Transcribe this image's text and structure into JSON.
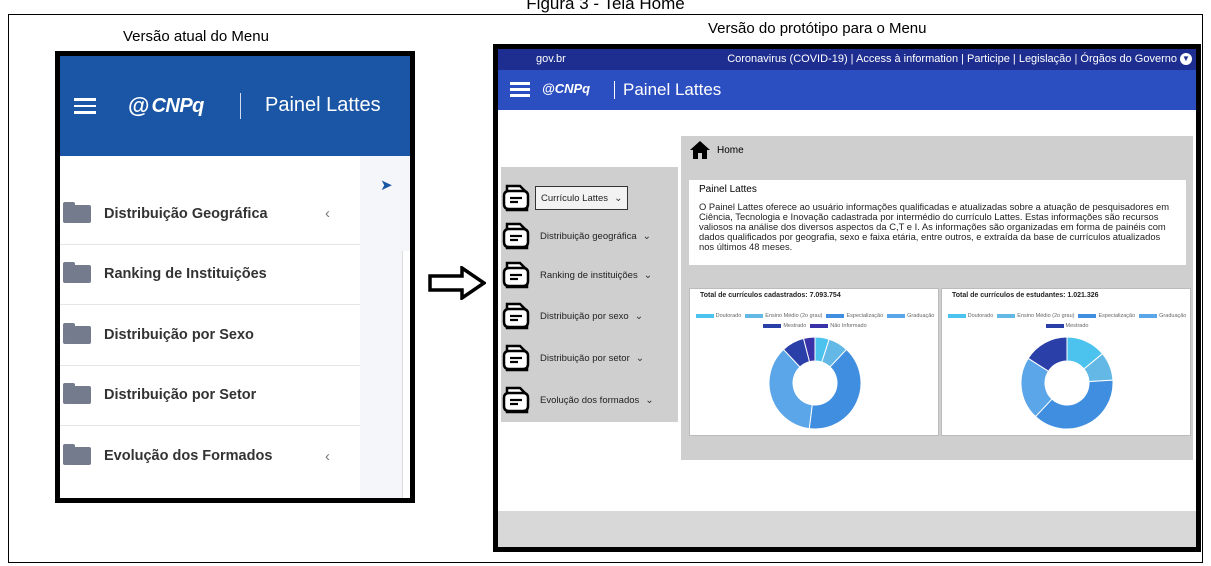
{
  "figure": {
    "title": "Figura 3 - Tela Home",
    "caption_left": "Versão atual do Menu",
    "caption_right": "Versão do protótipo para o Menu"
  },
  "current_menu": {
    "logo": "CNPq",
    "title": "Painel Lattes",
    "items": [
      {
        "label": "Distribuição Geográfica",
        "chevron": "‹"
      },
      {
        "label": "Ranking de Instituições",
        "chevron": ""
      },
      {
        "label": "Distribuição por Sexo",
        "chevron": ""
      },
      {
        "label": "Distribuição por Setor",
        "chevron": ""
      },
      {
        "label": "Evolução dos Formados",
        "chevron": "‹"
      }
    ]
  },
  "prototype": {
    "gov_bar": {
      "brand": "gov.br",
      "links": "Coronavirus (COVID-19) | Access à information | Participe | Legislação | Órgãos do Governo",
      "toggle_icon": "chevron-down-icon"
    },
    "header": {
      "logo": "CNPq",
      "title": "Painel Lattes"
    },
    "sidebar": [
      {
        "label": "Currículo Lattes",
        "active": true
      },
      {
        "label": "Distribuição geográfica",
        "active": false
      },
      {
        "label": "Ranking de instituições",
        "active": false
      },
      {
        "label": "Distribuição por sexo",
        "active": false
      },
      {
        "label": "Distribuição por setor",
        "active": false
      },
      {
        "label": "Evolução dos formados",
        "active": false
      }
    ],
    "breadcrumb": "Home",
    "info": {
      "heading": "Painel Lattes",
      "text": "O Painel Lattes oferece ao usuário informações qualificadas e atualizadas sobre a atuação de pesquisadores em Ciência, Tecnologia e Inovação cadastrada por intermédio do currículo Lattes. Estas informações são recursos valiosos na análise dos diversos aspectos da C,T e I. As informações são organizadas em forma de painéis com dados qualificados por geografia, sexo e faixa etária, entre outros, e extraída da base de currículos atualizados nos últimos 48 meses."
    },
    "charts": [
      {
        "title": "Total de currículos cadastrados: 7.093.754",
        "legend": [
          {
            "name": "Doutorado",
            "color": "#4cc3ee"
          },
          {
            "name": "Ensino Médio (2o grau)",
            "color": "#63b8e6"
          },
          {
            "name": "Especialização",
            "color": "#3f8ee0"
          },
          {
            "name": "Graduação",
            "color": "#5aa6e8"
          },
          {
            "name": "Mestrado",
            "color": "#2a3fa8"
          },
          {
            "name": "Não Informado",
            "color": "#3a32a8"
          }
        ],
        "slices": [
          {
            "color": "#4cc3ee",
            "value": 0.05
          },
          {
            "color": "#63b8e6",
            "value": 0.07
          },
          {
            "color": "#3f8ee0",
            "value": 0.4
          },
          {
            "color": "#5aa6e8",
            "value": 0.36
          },
          {
            "color": "#2a3fa8",
            "value": 0.08
          },
          {
            "color": "#3a32a8",
            "value": 0.04
          }
        ]
      },
      {
        "title": "Total de currículos de estudantes: 1.021.326",
        "legend": [
          {
            "name": "Doutorado",
            "color": "#4cc3ee"
          },
          {
            "name": "Ensino Médio (2o grau)",
            "color": "#63b8e6"
          },
          {
            "name": "Especialização",
            "color": "#3f8ee0"
          },
          {
            "name": "Graduação",
            "color": "#5aa6e8"
          },
          {
            "name": "Mestrado",
            "color": "#2a3fa8"
          }
        ],
        "slices": [
          {
            "color": "#4cc3ee",
            "value": 0.14
          },
          {
            "color": "#63b8e6",
            "value": 0.1
          },
          {
            "color": "#3f8ee0",
            "value": 0.38
          },
          {
            "color": "#5aa6e8",
            "value": 0.22
          },
          {
            "color": "#2a3fa8",
            "value": 0.16
          }
        ]
      }
    ]
  }
}
